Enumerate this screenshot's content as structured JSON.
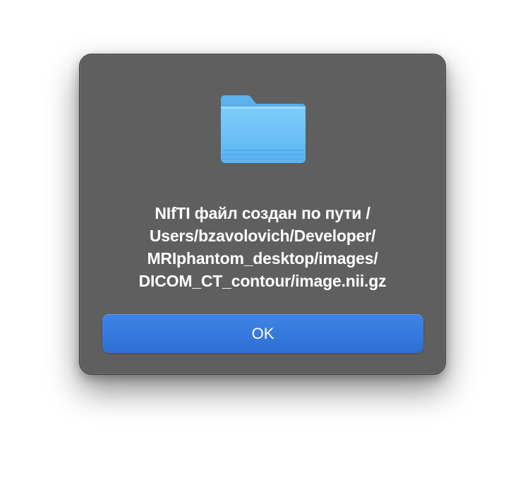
{
  "dialog": {
    "icon": "folder-icon",
    "message_lines": [
      "NIfTI файл создан по пути /",
      "Users/bzavolovich/Developer/",
      "MRIphantom_desktop/images/",
      "DICOM_CT_contour/image.nii.gz"
    ],
    "ok_label": "OK"
  },
  "colors": {
    "dialog_background": "#5f5f5f",
    "button_accent": "#3478e0",
    "folder_blue": "#6ac4f8",
    "text": "#ffffff"
  }
}
